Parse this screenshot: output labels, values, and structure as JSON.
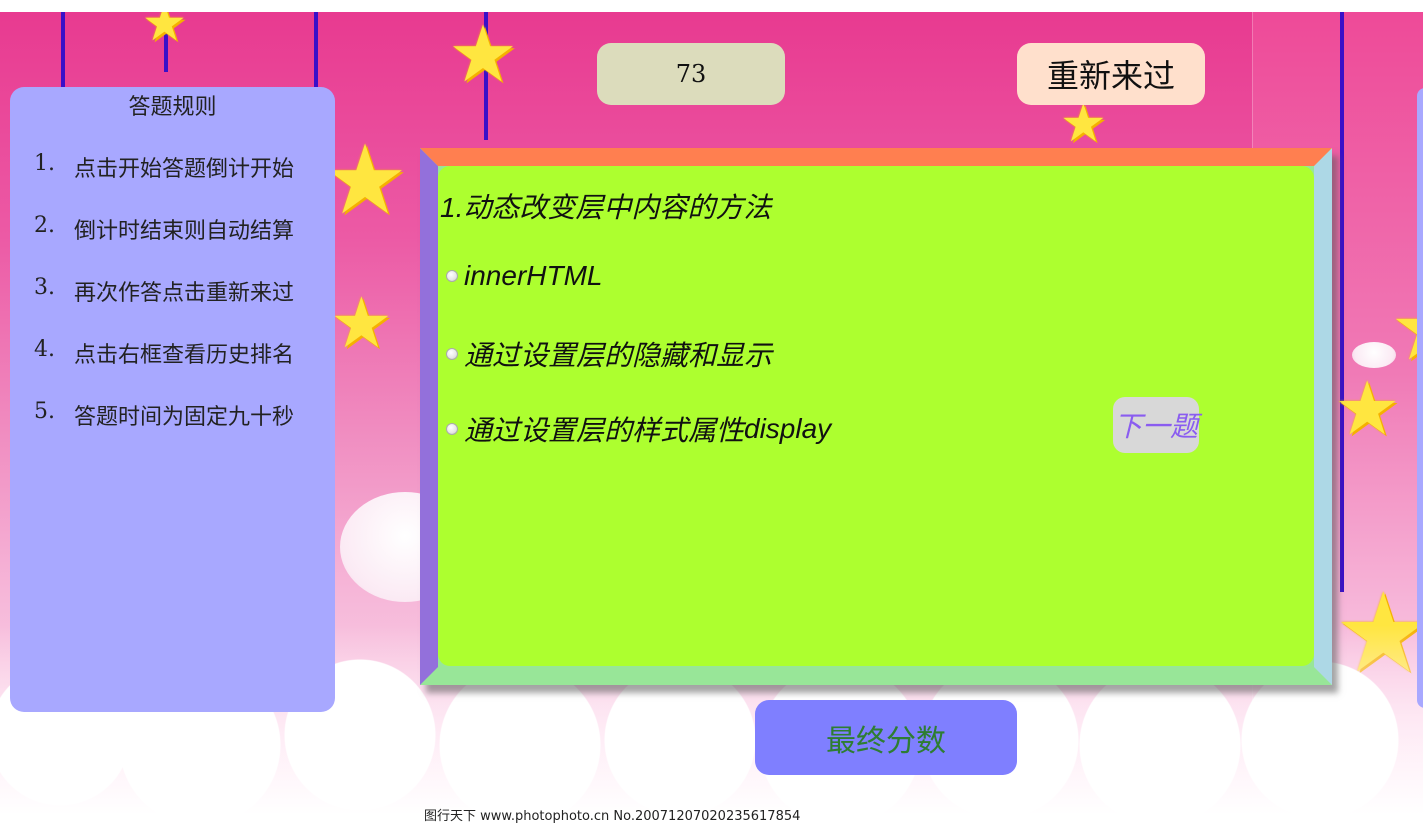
{
  "timer": {
    "value": "73"
  },
  "restart_button": {
    "label": "重新来过"
  },
  "rules": {
    "title": "答题规则",
    "items": [
      {
        "num": "1.",
        "text": "点击开始答题倒计开始"
      },
      {
        "num": "2.",
        "text": "倒计时结束则自动结算"
      },
      {
        "num": "3.",
        "text": "再次作答点击重新来过"
      },
      {
        "num": "4.",
        "text": "点击右框查看历史排名"
      },
      {
        "num": "5.",
        "text": "答题时间为固定九十秒"
      }
    ]
  },
  "quiz": {
    "question_number": "1.",
    "question_text": "动态改变层中内容的方法",
    "options": [
      {
        "cn": "",
        "latin": "innerHTML"
      },
      {
        "cn": "通过设置层的隐藏和显示",
        "latin": ""
      },
      {
        "cn": "通过设置层的样式属性",
        "latin": "display"
      }
    ],
    "next_label": "下一题"
  },
  "final_score_button": {
    "label": "最终分数"
  },
  "watermark": {
    "text": "图行天下  www.photophoto.cn  No.20071207020235617854"
  },
  "colors": {
    "timer_bg": "#dcdcbc",
    "restart_bg": "#ffe0cc",
    "rules_bg": "#a8a8ff",
    "quiz_bg": "#adff2f",
    "frame_top": "#ff7f50",
    "frame_left": "#9370db",
    "frame_right": "#add8e6",
    "frame_bottom": "#98e698",
    "final_bg": "#7f7fff",
    "final_text": "#2e7d32",
    "next_text": "#8a5cf0"
  }
}
